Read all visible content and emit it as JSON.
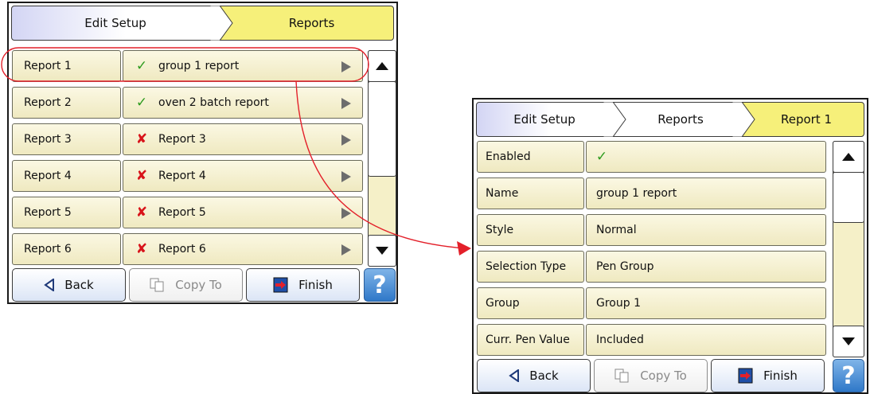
{
  "screen1": {
    "breadcrumb": [
      "Edit Setup",
      "Reports"
    ],
    "rows": [
      {
        "name": "Report 1",
        "status": "enabled",
        "value": "group 1 report"
      },
      {
        "name": "Report 2",
        "status": "enabled",
        "value": "oven 2 batch report"
      },
      {
        "name": "Report 3",
        "status": "disabled",
        "value": "Report 3"
      },
      {
        "name": "Report 4",
        "status": "disabled",
        "value": "Report 4"
      },
      {
        "name": "Report 5",
        "status": "disabled",
        "value": "Report 5"
      },
      {
        "name": "Report 6",
        "status": "disabled",
        "value": "Report 6"
      }
    ],
    "buttons": {
      "back": "Back",
      "copy_to": "Copy To",
      "finish": "Finish",
      "help": "?"
    }
  },
  "screen2": {
    "breadcrumb": [
      "Edit Setup",
      "Reports",
      "Report 1"
    ],
    "rows": [
      {
        "name": "Enabled",
        "value": "",
        "status": "enabled"
      },
      {
        "name": "Name",
        "value": "group 1 report"
      },
      {
        "name": "Style",
        "value": "Normal"
      },
      {
        "name": "Selection Type",
        "value": "Pen Group"
      },
      {
        "name": "Group",
        "value": "Group 1"
      },
      {
        "name": "Curr. Pen Value",
        "value": "Included"
      }
    ],
    "buttons": {
      "back": "Back",
      "copy_to": "Copy To",
      "finish": "Finish",
      "help": "?"
    }
  },
  "glyphs": {
    "check": "✓",
    "cross": "✘"
  },
  "colors": {
    "highlight": "#e3202a",
    "check": "#2e9b1f",
    "cross": "#d8131a",
    "active_crumb": "#f6f07a"
  }
}
